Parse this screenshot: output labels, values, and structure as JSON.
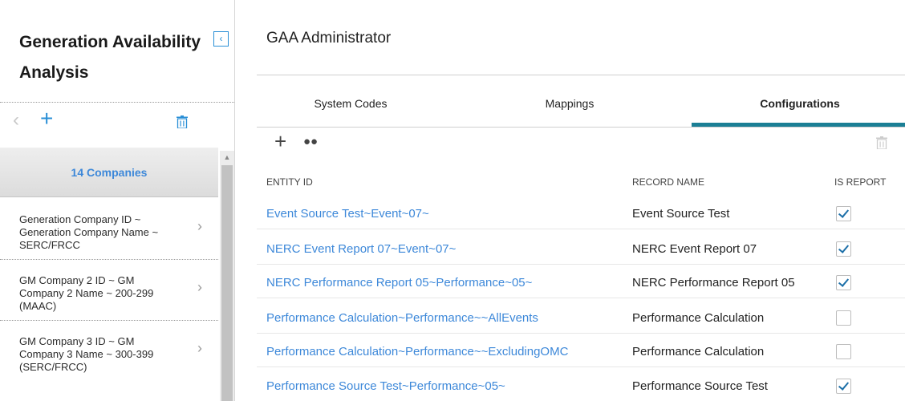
{
  "sidebar": {
    "title": "Generation Availability Analysis",
    "list_header": "14 Companies",
    "items": [
      {
        "label": "Generation Company ID ~ Generation Company Name ~ SERC/FRCC"
      },
      {
        "label": "GM Company 2 ID ~ GM Company 2 Name ~ 200-299 (MAAC)"
      },
      {
        "label": "GM Company 3 ID ~ GM Company 3 Name ~ 300-399 (SERC/FRCC)"
      }
    ]
  },
  "icons": {
    "collapse": "chevron-left-icon",
    "back": "chevron-left-icon",
    "add": "plus-icon",
    "delete": "trash-icon",
    "search": "binoculars-icon"
  },
  "main": {
    "title": "GAA Administrator",
    "tabs": [
      {
        "label": "System Codes",
        "active": false
      },
      {
        "label": "Mappings",
        "active": false
      },
      {
        "label": "Configurations",
        "active": true
      }
    ],
    "table": {
      "headers": [
        "ENTITY ID",
        "RECORD NAME",
        "IS REPORT"
      ],
      "rows": [
        {
          "entity_id": "Event Source Test~Event~07~",
          "record_name": "Event Source Test",
          "is_report": true
        },
        {
          "entity_id": "NERC Event Report 07~Event~07~",
          "record_name": "NERC Event Report 07",
          "is_report": true
        },
        {
          "entity_id": "NERC Performance Report 05~Performance~05~",
          "record_name": "NERC Performance Report 05",
          "is_report": true
        },
        {
          "entity_id": "Performance Calculation~Performance~~AllEvents",
          "record_name": "Performance Calculation",
          "is_report": false
        },
        {
          "entity_id": "Performance Calculation~Performance~~ExcludingOMC",
          "record_name": "Performance Calculation",
          "is_report": false
        },
        {
          "entity_id": "Performance Source Test~Performance~05~",
          "record_name": "Performance Source Test",
          "is_report": true
        }
      ]
    }
  },
  "colors": {
    "accent": "#3d88d9",
    "tab_underline": "#1b7f95"
  }
}
